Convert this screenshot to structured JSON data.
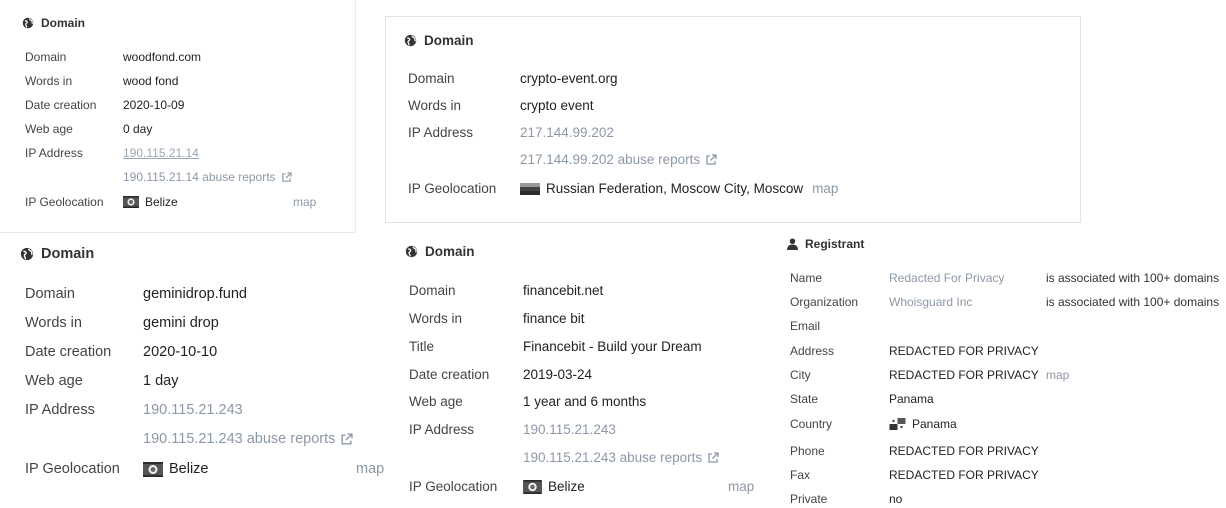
{
  "panel1": {
    "title": "Domain",
    "labels": {
      "domain": "Domain",
      "words": "Words in",
      "date": "Date creation",
      "age": "Web age",
      "ip": "IP Address",
      "geo": "IP Geolocation"
    },
    "domain": "woodfond.com",
    "words": "wood fond",
    "date": "2020-10-09",
    "age": "0 day",
    "ip": "190.115.21.14",
    "abuse": "190.115.21.14 abuse reports",
    "geo": "Belize",
    "map": "map"
  },
  "panel2": {
    "title": "Domain",
    "labels": {
      "domain": "Domain",
      "words": "Words in",
      "ip": "IP Address",
      "geo": "IP Geolocation"
    },
    "domain": "crypto-event.org",
    "words": "crypto event",
    "ip": "217.144.99.202",
    "abuse": "217.144.99.202 abuse reports",
    "geo": "Russian Federation, Moscow City, Moscow",
    "map": "map"
  },
  "panel3": {
    "title": "Domain",
    "labels": {
      "domain": "Domain",
      "words": "Words in",
      "date": "Date creation",
      "age": "Web age",
      "ip": "IP Address",
      "geo": "IP Geolocation"
    },
    "domain": "geminidrop.fund",
    "words": "gemini drop",
    "date": "2020-10-10",
    "age": "1 day",
    "ip": "190.115.21.243",
    "abuse": "190.115.21.243 abuse reports",
    "geo": "Belize",
    "map": "map"
  },
  "panel4": {
    "title": "Domain",
    "labels": {
      "domain": "Domain",
      "words": "Words in",
      "title": "Title",
      "date": "Date creation",
      "age": "Web age",
      "ip": "IP Address",
      "geo": "IP Geolocation"
    },
    "domain": "financebit.net",
    "words": "finance bit",
    "site_title": "Financebit - Build your Dream",
    "date": "2019-03-24",
    "age": "1 year and 6 months",
    "ip": "190.115.21.243",
    "abuse": "190.115.21.243 abuse reports",
    "geo": "Belize",
    "map": "map"
  },
  "panel5": {
    "title": "Registrant",
    "labels": {
      "name": "Name",
      "org": "Organization",
      "email": "Email",
      "address": "Address",
      "city": "City",
      "state": "State",
      "country": "Country",
      "phone": "Phone",
      "fax": "Fax",
      "private": "Private"
    },
    "name": "Redacted For Privacy",
    "name_note": "is associated with 100+ domains",
    "org": "Whoisguard Inc",
    "org_note": "is associated with 100+ domains",
    "email": "",
    "address": "REDACTED FOR PRIVACY",
    "city": "REDACTED FOR PRIVACY",
    "city_map": "map",
    "state": "Panama",
    "country": "Panama",
    "phone": "REDACTED FOR PRIVACY",
    "fax": "REDACTED FOR PRIVACY",
    "private": "no"
  },
  "icons": {
    "globe": "globe-icon",
    "user": "user-icon",
    "external": "external-link-icon",
    "flag_belize": "belize-flag-icon",
    "flag_russia": "russia-flag-icon",
    "flag_panama": "panama-flag-icon"
  }
}
